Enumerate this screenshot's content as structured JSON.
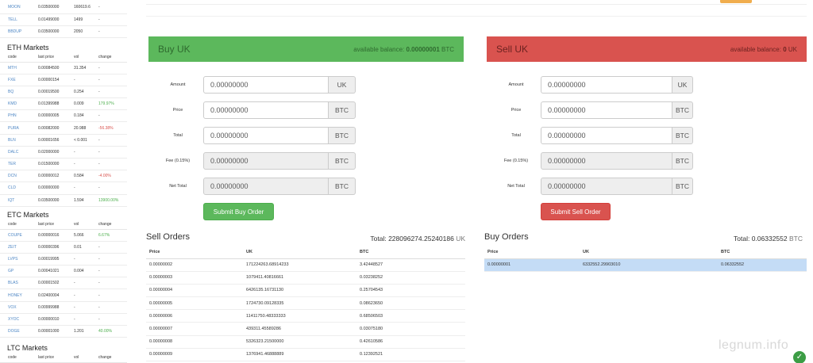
{
  "sidebar": {
    "columns": [
      "code",
      "last price",
      "vol",
      "change"
    ],
    "top_rows": [
      {
        "code": "MOON",
        "price": "0.03500000",
        "vol": "160619.638",
        "change": "-"
      },
      {
        "code": "TELL",
        "price": "0.01499000",
        "vol": "1499",
        "change": "-"
      },
      {
        "code": "BBDUP",
        "price": "0.03500000",
        "vol": "2050",
        "change": "-"
      }
    ],
    "eth": {
      "title": "ETH Markets",
      "rows": [
        {
          "code": "MTH",
          "price": "0.00084500",
          "vol": "31.354",
          "change": "-",
          "trend": ""
        },
        {
          "code": "FXE",
          "price": "0.00000154",
          "vol": "-",
          "change": "-",
          "trend": ""
        },
        {
          "code": "BQ",
          "price": "0.00019500",
          "vol": "0.254",
          "change": "-",
          "trend": ""
        },
        {
          "code": "KMD",
          "price": "0.01399988",
          "vol": "0.009",
          "change": "179.97%",
          "trend": "pos"
        },
        {
          "code": "PHN",
          "price": "0.00000005",
          "vol": "0.184",
          "change": "-",
          "trend": ""
        },
        {
          "code": "PURA",
          "price": "0.00082000",
          "vol": "20.988",
          "change": "-56.38%",
          "trend": "neg"
        },
        {
          "code": "BLN",
          "price": "0.00001656",
          "vol": "< 0.001",
          "change": "-",
          "trend": ""
        },
        {
          "code": "DALC",
          "price": "0.02000000",
          "vol": "-",
          "change": "-",
          "trend": ""
        },
        {
          "code": "TER",
          "price": "0.01500000",
          "vol": "-",
          "change": "-",
          "trend": ""
        },
        {
          "code": "DCN",
          "price": "0.00000012",
          "vol": "0.584",
          "change": "-4.00%",
          "trend": "neg"
        },
        {
          "code": "CLD",
          "price": "0.00000000",
          "vol": "-",
          "change": "-",
          "trend": ""
        },
        {
          "code": "IQT",
          "price": "0.03500000",
          "vol": "1.594",
          "change": "13900.00%",
          "trend": "pos"
        }
      ]
    },
    "etc": {
      "title": "ETC Markets",
      "rows": [
        {
          "code": "COUPE",
          "price": "0.00000016",
          "vol": "5.066",
          "change": "6.67%",
          "trend": "pos"
        },
        {
          "code": "ZEIT",
          "price": "0.00000396",
          "vol": "0.01",
          "change": "-",
          "trend": ""
        },
        {
          "code": "LVPS",
          "price": "0.00019995",
          "vol": "-",
          "change": "-",
          "trend": ""
        },
        {
          "code": "GP",
          "price": "0.00041021",
          "vol": "0.004",
          "change": "-",
          "trend": ""
        },
        {
          "code": "BLAS",
          "price": "0.00001502",
          "vol": "-",
          "change": "-",
          "trend": ""
        },
        {
          "code": "HONEY",
          "price": "0.02400004",
          "vol": "-",
          "change": "-",
          "trend": ""
        },
        {
          "code": "VOX",
          "price": "0.00999988",
          "vol": "-",
          "change": "-",
          "trend": ""
        },
        {
          "code": "XYOC",
          "price": "0.00000010",
          "vol": "-",
          "change": "-",
          "trend": ""
        },
        {
          "code": "DOGE",
          "price": "0.00001000",
          "vol": "1.201",
          "change": "40.00%",
          "trend": "pos"
        }
      ]
    },
    "ltc": {
      "title": "LTC Markets"
    }
  },
  "buy_panel": {
    "title": "Buy UK",
    "balance_label": "available balance:",
    "balance_value": "0.00000001",
    "balance_unit": "BTC",
    "fields": [
      {
        "label": "Amount",
        "value": "0.00000000",
        "unit": "UK"
      },
      {
        "label": "Price",
        "value": "0.00000000",
        "unit": "BTC"
      },
      {
        "label": "Total",
        "value": "0.00000000",
        "unit": "BTC"
      },
      {
        "label": "Fee (0.15%)",
        "value": "0.00000000",
        "unit": "BTC"
      },
      {
        "label": "Net Total",
        "value": "0.00000000",
        "unit": "BTC"
      }
    ],
    "button": "Submit Buy Order"
  },
  "sell_panel": {
    "title": "Sell UK",
    "balance_label": "available balance:",
    "balance_value": "0",
    "balance_unit": "UK",
    "fields": [
      {
        "label": "Amount",
        "value": "0.00000000",
        "unit": "UK"
      },
      {
        "label": "Price",
        "value": "0.00000000",
        "unit": "BTC"
      },
      {
        "label": "Total",
        "value": "0.00000000",
        "unit": "BTC"
      },
      {
        "label": "Fee (0.15%)",
        "value": "0.00000000",
        "unit": "BTC"
      },
      {
        "label": "Net Total",
        "value": "0.00000000",
        "unit": "BTC"
      }
    ],
    "button": "Submit Sell Order"
  },
  "sell_orders": {
    "title": "Sell Orders",
    "total_label": "Total:",
    "total_value": "228096274.25240186",
    "total_unit": "UK",
    "columns": [
      "Price",
      "UK",
      "BTC"
    ],
    "rows": [
      [
        "0.00000002",
        "171224263.68914233",
        "3.42448527"
      ],
      [
        "0.00000003",
        "1079411.40816661",
        "0.03238252"
      ],
      [
        "0.00000004",
        "6426135.16731130",
        "0.25704543"
      ],
      [
        "0.00000005",
        "1724730.09128335",
        "0.08623650"
      ],
      [
        "0.00000006",
        "11411750.48333333",
        "0.68506503"
      ],
      [
        "0.00000007",
        "439311.45589286",
        "0.03075180"
      ],
      [
        "0.00000008",
        "5326323.21500000",
        "0.42610586"
      ],
      [
        "0.00000009",
        "1376941.46888889",
        "0.12392521"
      ]
    ]
  },
  "buy_orders": {
    "title": "Buy Orders",
    "total_label": "Total:",
    "total_value": "0.06332552",
    "total_unit": "BTC",
    "columns": [
      "Price",
      "UK",
      "BTC"
    ],
    "rows": [
      [
        "0.00000001",
        "6332552.29903010",
        "0.06332552"
      ]
    ]
  },
  "watermark": "legnum.info"
}
